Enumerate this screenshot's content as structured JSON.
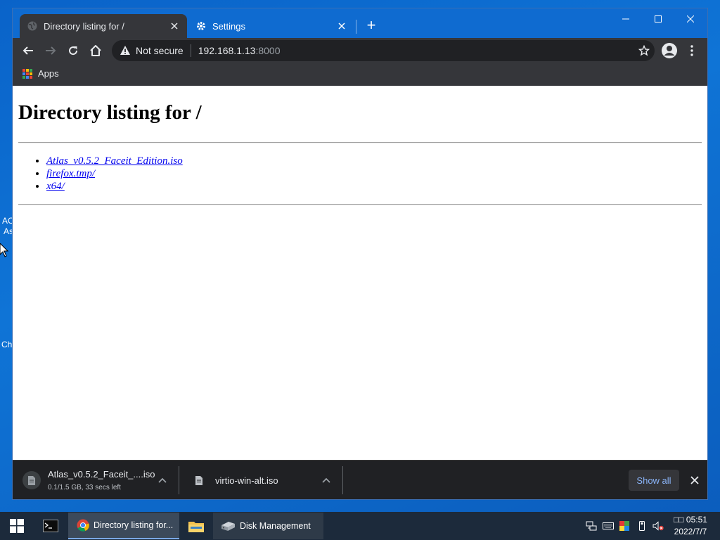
{
  "desktop": {
    "fragments": [
      "AC",
      "As",
      "Ch"
    ]
  },
  "browser": {
    "tabs": [
      {
        "title": "Directory listing for /",
        "active": true,
        "icon": "globe-icon"
      },
      {
        "title": "Settings",
        "active": false,
        "icon": "gear-icon"
      }
    ],
    "toolbar": {
      "security_label": "Not secure",
      "url_host": "192.168.1.13",
      "url_port": ":8000"
    },
    "bookmarks": {
      "apps_label": "Apps"
    },
    "page": {
      "heading": "Directory listing for /",
      "links": [
        "Atlas_v0.5.2_Faceit_Edition.iso",
        "firefox.tmp/",
        "x64/"
      ]
    },
    "downloads": {
      "items": [
        {
          "name": "Atlas_v0.5.2_Faceit_....iso",
          "status": "0.1/1.5 GB, 33 secs left"
        },
        {
          "name": "virtio-win-alt.iso",
          "status": ""
        }
      ],
      "show_all_label": "Show all"
    }
  },
  "taskbar": {
    "apps": [
      {
        "label": "Directory listing for...",
        "icon": "chrome-icon"
      },
      {
        "label": "Disk Management",
        "icon": "disk-management-icon"
      }
    ],
    "clock": {
      "time": "□□ 05:51",
      "date": "2022/7/7"
    }
  },
  "colors": {
    "desktop_bg": "#0f6bd0",
    "tabstrip": "#0f6bd0",
    "toolbar": "#35363a",
    "link": "#0000ee",
    "show_all": "#8ab4f8",
    "taskbar": "#1c2a3b"
  }
}
